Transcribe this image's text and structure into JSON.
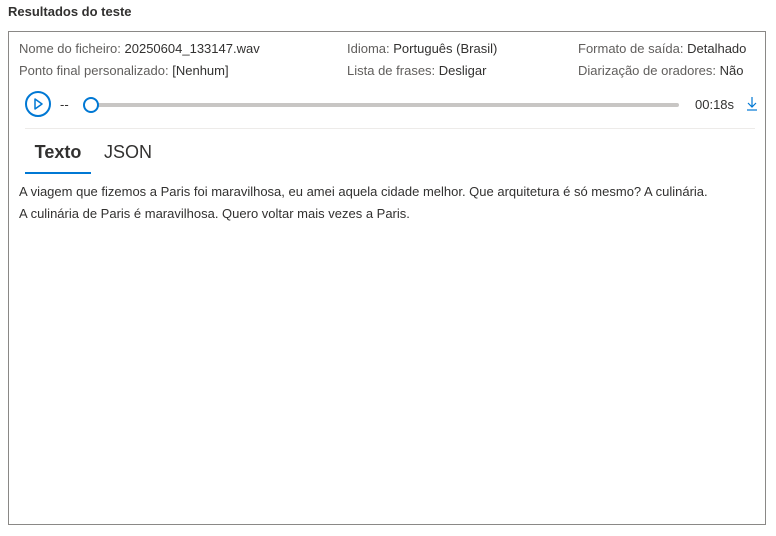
{
  "section": {
    "title": "Resultados do teste"
  },
  "meta": {
    "filename": {
      "label": "Nome do ficheiro:",
      "value": "20250604_133147.wav"
    },
    "language": {
      "label": "Idioma:",
      "value": "Português (Brasil)"
    },
    "output_format": {
      "label": "Formato de saída:",
      "value": "Detalhado"
    },
    "custom_endpoint": {
      "label": "Ponto final personalizado:",
      "value": "[Nenhum]"
    },
    "phrase_list": {
      "label": "Lista de frases:",
      "value": "Desligar"
    },
    "diarization": {
      "label": "Diarização de oradores:",
      "value": "Não"
    }
  },
  "player": {
    "current_time": "--",
    "duration": "00:18s",
    "progress": 0
  },
  "tabs": [
    {
      "label": "Texto",
      "active": true
    },
    {
      "label": "JSON",
      "active": false
    }
  ],
  "transcript": {
    "line1": "A viagem que fizemos a Paris foi maravilhosa, eu amei aquela cidade melhor. Que arquitetura é só mesmo? A culinária.",
    "line2": "A culinária de Paris é maravilhosa. Quero voltar mais vezes a Paris."
  },
  "colors": {
    "accent": "#0078d4",
    "border": "#8a8886",
    "track": "#c8c6c4"
  }
}
